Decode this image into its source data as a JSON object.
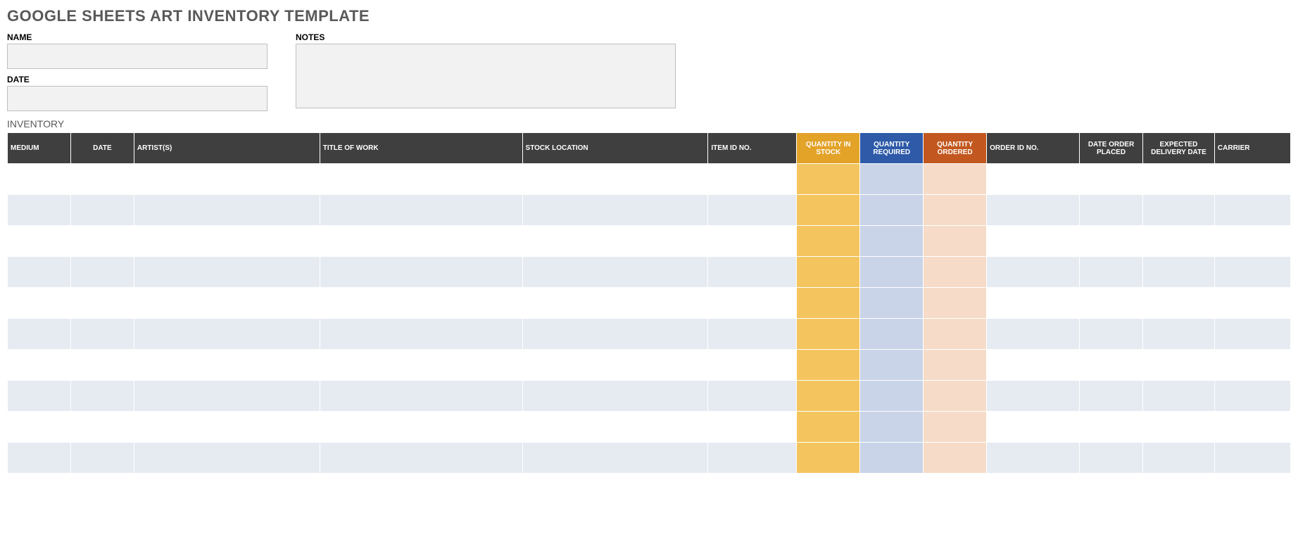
{
  "title": "GOOGLE SHEETS ART INVENTORY TEMPLATE",
  "form": {
    "name_label": "NAME",
    "name_value": "",
    "date_label": "DATE",
    "date_value": "",
    "notes_label": "NOTES",
    "notes_value": ""
  },
  "section": {
    "inventory_label": "INVENTORY"
  },
  "columns": {
    "medium": "MEDIUM",
    "date": "DATE",
    "artist": "ARTIST(S)",
    "title_of_work": "TITLE OF WORK",
    "stock_location": "STOCK LOCATION",
    "item_id_no": "ITEM ID NO.",
    "qty_in_stock": "QUANTITY IN STOCK",
    "qty_required": "QUANTITY REQUIRED",
    "qty_ordered": "QUANTITY ORDERED",
    "order_id_no": "ORDER ID NO.",
    "date_order_placed": "DATE ORDER PLACED",
    "expected_delivery": "EXPECTED DELIVERY DATE",
    "carrier": "CARRIER"
  },
  "rows": [
    {
      "medium": "",
      "date": "",
      "artist": "",
      "title_of_work": "",
      "stock_location": "",
      "item_id_no": "",
      "qty_in_stock": "",
      "qty_required": "",
      "qty_ordered": "",
      "order_id_no": "",
      "date_order_placed": "",
      "expected_delivery": "",
      "carrier": ""
    },
    {
      "medium": "",
      "date": "",
      "artist": "",
      "title_of_work": "",
      "stock_location": "",
      "item_id_no": "",
      "qty_in_stock": "",
      "qty_required": "",
      "qty_ordered": "",
      "order_id_no": "",
      "date_order_placed": "",
      "expected_delivery": "",
      "carrier": ""
    },
    {
      "medium": "",
      "date": "",
      "artist": "",
      "title_of_work": "",
      "stock_location": "",
      "item_id_no": "",
      "qty_in_stock": "",
      "qty_required": "",
      "qty_ordered": "",
      "order_id_no": "",
      "date_order_placed": "",
      "expected_delivery": "",
      "carrier": ""
    },
    {
      "medium": "",
      "date": "",
      "artist": "",
      "title_of_work": "",
      "stock_location": "",
      "item_id_no": "",
      "qty_in_stock": "",
      "qty_required": "",
      "qty_ordered": "",
      "order_id_no": "",
      "date_order_placed": "",
      "expected_delivery": "",
      "carrier": ""
    },
    {
      "medium": "",
      "date": "",
      "artist": "",
      "title_of_work": "",
      "stock_location": "",
      "item_id_no": "",
      "qty_in_stock": "",
      "qty_required": "",
      "qty_ordered": "",
      "order_id_no": "",
      "date_order_placed": "",
      "expected_delivery": "",
      "carrier": ""
    },
    {
      "medium": "",
      "date": "",
      "artist": "",
      "title_of_work": "",
      "stock_location": "",
      "item_id_no": "",
      "qty_in_stock": "",
      "qty_required": "",
      "qty_ordered": "",
      "order_id_no": "",
      "date_order_placed": "",
      "expected_delivery": "",
      "carrier": ""
    },
    {
      "medium": "",
      "date": "",
      "artist": "",
      "title_of_work": "",
      "stock_location": "",
      "item_id_no": "",
      "qty_in_stock": "",
      "qty_required": "",
      "qty_ordered": "",
      "order_id_no": "",
      "date_order_placed": "",
      "expected_delivery": "",
      "carrier": ""
    },
    {
      "medium": "",
      "date": "",
      "artist": "",
      "title_of_work": "",
      "stock_location": "",
      "item_id_no": "",
      "qty_in_stock": "",
      "qty_required": "",
      "qty_ordered": "",
      "order_id_no": "",
      "date_order_placed": "",
      "expected_delivery": "",
      "carrier": ""
    },
    {
      "medium": "",
      "date": "",
      "artist": "",
      "title_of_work": "",
      "stock_location": "",
      "item_id_no": "",
      "qty_in_stock": "",
      "qty_required": "",
      "qty_ordered": "",
      "order_id_no": "",
      "date_order_placed": "",
      "expected_delivery": "",
      "carrier": ""
    },
    {
      "medium": "",
      "date": "",
      "artist": "",
      "title_of_work": "",
      "stock_location": "",
      "item_id_no": "",
      "qty_in_stock": "",
      "qty_required": "",
      "qty_ordered": "",
      "order_id_no": "",
      "date_order_placed": "",
      "expected_delivery": "",
      "carrier": ""
    }
  ]
}
